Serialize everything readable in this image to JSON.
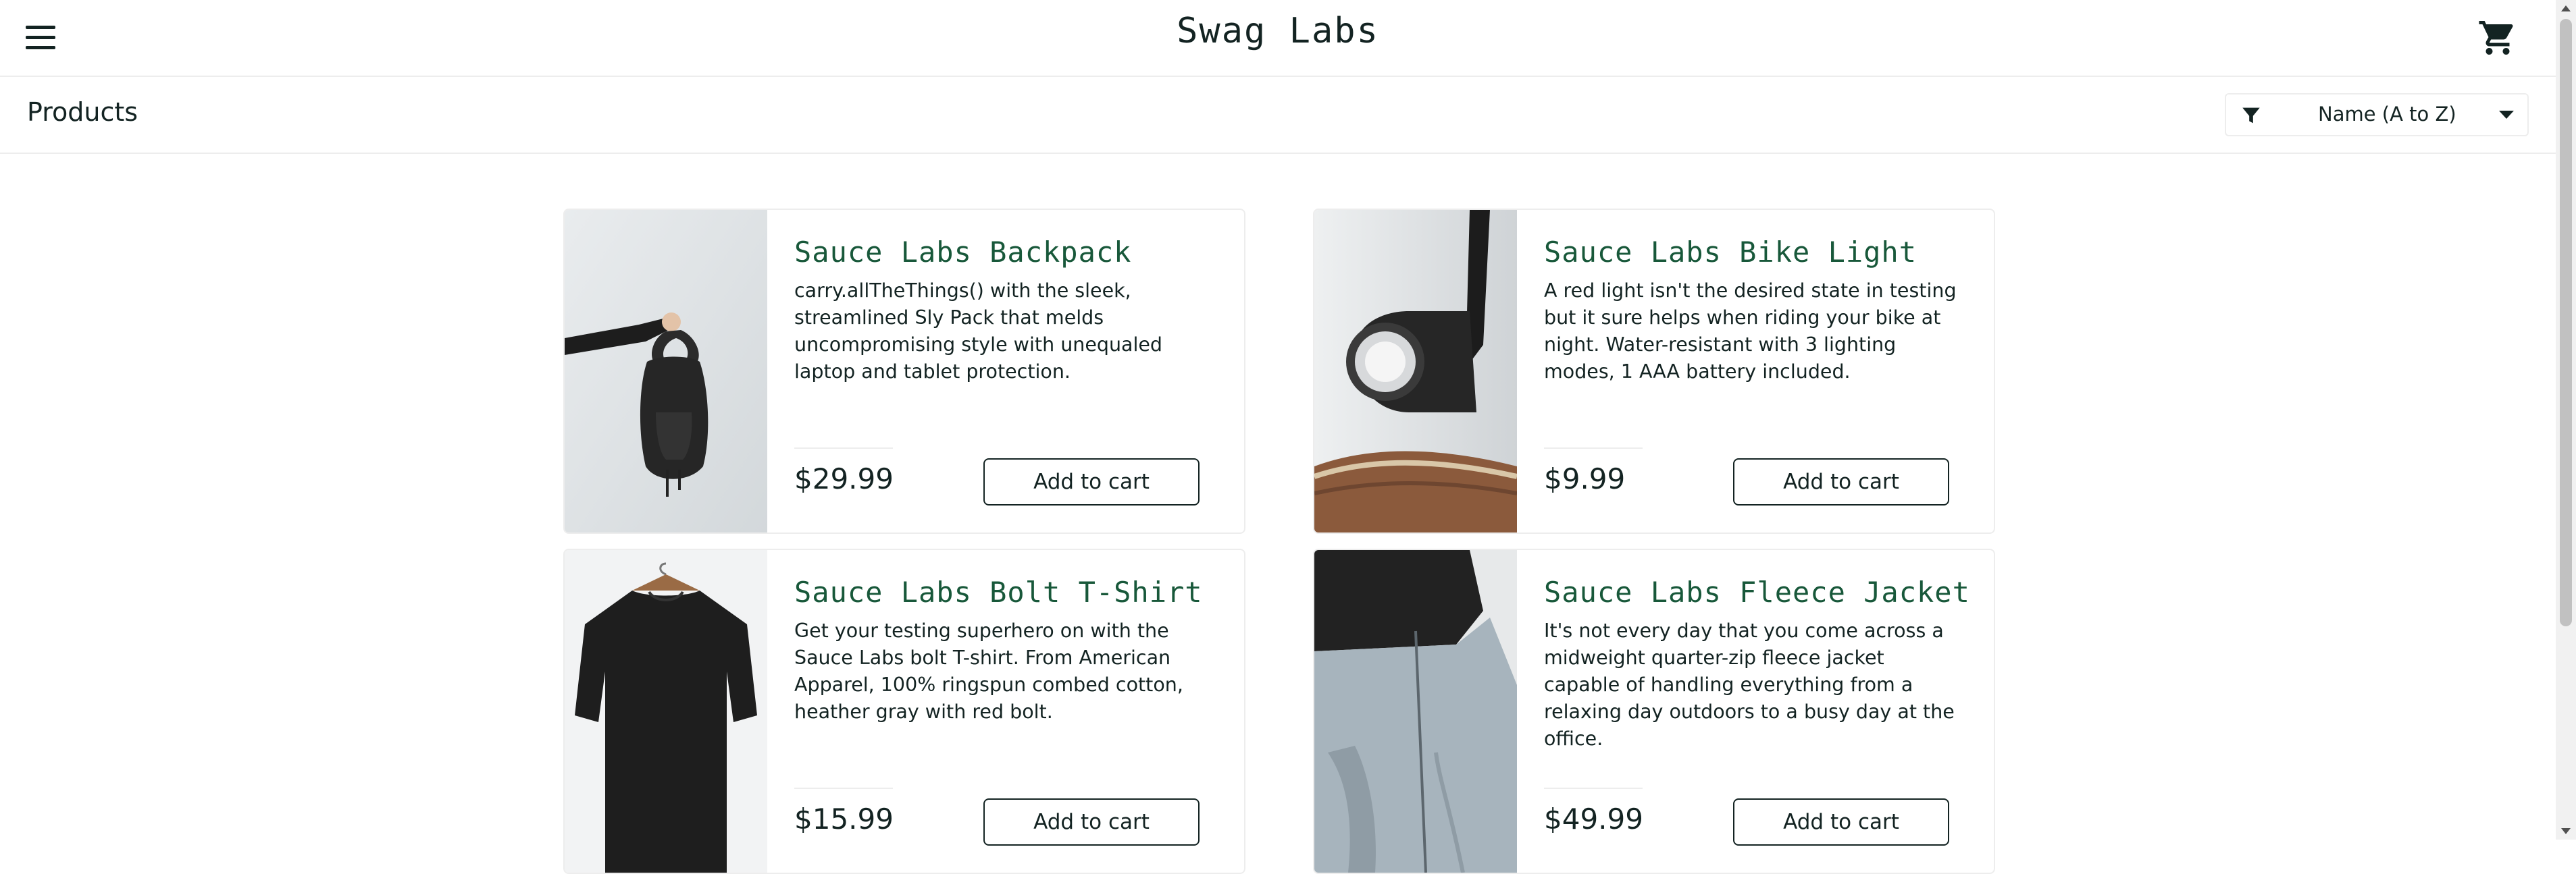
{
  "header": {
    "app_logo": "Swag Labs"
  },
  "secondary_header": {
    "title": "Products",
    "sort_selected": "Name (A to Z)"
  },
  "products": [
    {
      "name": "Sauce Labs Backpack",
      "description": "carry.allTheThings() with the sleek, streamlined Sly Pack that melds uncompromising style with unequaled laptop and tablet protection.",
      "price": "$29.99",
      "button": "Add to cart"
    },
    {
      "name": "Sauce Labs Bike Light",
      "description": "A red light isn't the desired state in testing but it sure helps when riding your bike at night. Water-resistant with 3 lighting modes, 1 AAA battery included.",
      "price": "$9.99",
      "button": "Add to cart"
    },
    {
      "name": "Sauce Labs Bolt T-Shirt",
      "description": "Get your testing superhero on with the Sauce Labs bolt T-shirt. From American Apparel, 100% ringspun combed cotton, heather gray with red bolt.",
      "price": "$15.99",
      "button": "Add to cart"
    },
    {
      "name": "Sauce Labs Fleece Jacket",
      "description": "It's not every day that you come across a midweight quarter-zip fleece jacket capable of handling everything from a relaxing day outdoors to a busy day at the office.",
      "price": "$49.99",
      "button": "Add to cart"
    }
  ],
  "icons": {
    "menu": "hamburger-menu-icon",
    "cart": "shopping-cart-icon",
    "filter": "filter-icon",
    "caret": "caret-down-icon"
  }
}
